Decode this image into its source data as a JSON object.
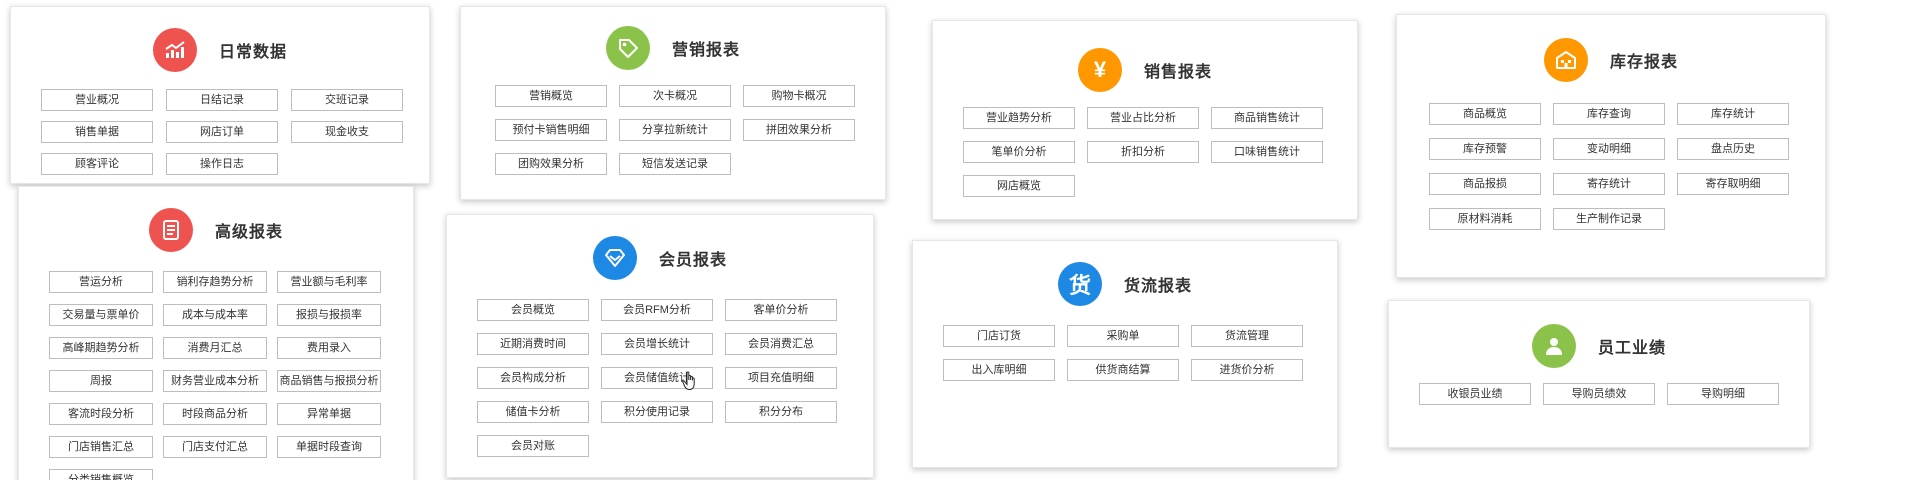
{
  "cards": {
    "daily": {
      "title": "日常数据",
      "color": "#ef5350",
      "icon": "chart-icon",
      "items": [
        "营业概况",
        "日结记录",
        "交班记录",
        "销售单据",
        "网店订单",
        "现金收支",
        "顾客评论",
        "操作日志"
      ]
    },
    "marketing": {
      "title": "营销报表",
      "color": "#8bc34a",
      "icon": "tag-icon",
      "items": [
        "营销概览",
        "次卡概况",
        "购物卡概况",
        "预付卡销售明细",
        "分享拉新统计",
        "拼团效果分析",
        "团购效果分析",
        "短信发送记录"
      ]
    },
    "sales": {
      "title": "销售报表",
      "color": "#ff9800",
      "icon": "yen-icon",
      "items": [
        "营业趋势分析",
        "营业占比分析",
        "商品销售统计",
        "笔单价分析",
        "折扣分析",
        "口味销售统计",
        "网店概览"
      ]
    },
    "inventory": {
      "title": "库存报表",
      "color": "#ff9800",
      "icon": "warehouse-icon",
      "items": [
        "商品概览",
        "库存查询",
        "库存统计",
        "库存预警",
        "变动明细",
        "盘点历史",
        "商品报损",
        "寄存统计",
        "寄存取明细",
        "原材料消耗",
        "生产制作记录"
      ]
    },
    "advanced": {
      "title": "高级报表",
      "color": "#ef5350",
      "icon": "document-icon",
      "items": [
        "营运分析",
        "销利存趋势分析",
        "营业额与毛利率",
        "交易量与票单价",
        "成本与成本率",
        "报损与报损率",
        "高峰期趋势分析",
        "消费月汇总",
        "费用录入",
        "周报",
        "财务营业成本分析",
        "商品销售与报损分析",
        "客流时段分析",
        "时段商品分析",
        "异常单据",
        "门店销售汇总",
        "门店支付汇总",
        "单据时段查询",
        "分类销售概览"
      ]
    },
    "member": {
      "title": "会员报表",
      "color": "#1e88e5",
      "icon": "diamond-icon",
      "items": [
        "会员概览",
        "会员RFM分析",
        "客单价分析",
        "近期消费时间",
        "会员增长统计",
        "会员消费汇总",
        "会员构成分析",
        "会员储值统计",
        "项目充值明细",
        "储值卡分析",
        "积分使用记录",
        "积分分布",
        "会员对账"
      ]
    },
    "logistics": {
      "title": "货流报表",
      "color": "#1e88e5",
      "icon": "goods-char-icon",
      "glyph": "货",
      "items": [
        "门店订货",
        "采购单",
        "货流管理",
        "出入库明细",
        "供货商结算",
        "进货价分析"
      ]
    },
    "staff": {
      "title": "员工业绩",
      "color": "#8bc34a",
      "icon": "person-icon",
      "items": [
        "收银员业绩",
        "导购员绩效",
        "导购明细"
      ]
    }
  }
}
